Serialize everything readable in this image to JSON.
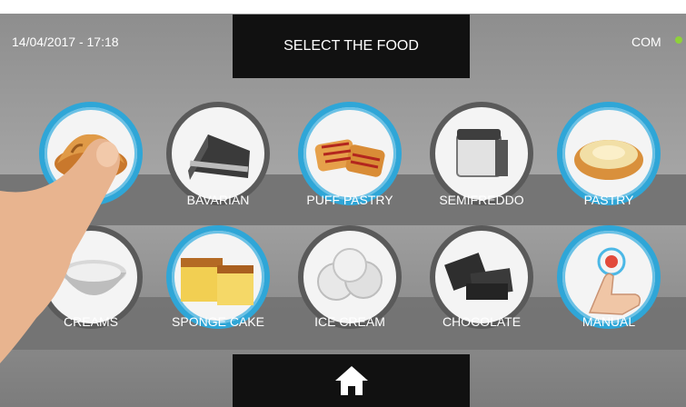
{
  "header": {
    "datetime": "14/04/2017 - 17:18",
    "title": "SELECT THE FOOD",
    "status_label": "COM",
    "status_color": "#8ed13a"
  },
  "foods": [
    {
      "label": "CROISSANTERIE",
      "visible_label": "E",
      "icon": "croissant-icon",
      "active": true
    },
    {
      "label": "BAVARIAN",
      "icon": "cake-slice-icon",
      "active": false
    },
    {
      "label": "PUFF PASTRY",
      "icon": "puff-pastry-icon",
      "active": true
    },
    {
      "label": "SEMIFREDDO",
      "icon": "semifreddo-icon",
      "active": false
    },
    {
      "label": "PASTRY",
      "icon": "tart-icon",
      "active": true
    },
    {
      "label": "CREAMS",
      "icon": "cream-bowl-icon",
      "active": false
    },
    {
      "label": "SPONGE CAKE",
      "icon": "sponge-cake-icon",
      "active": true
    },
    {
      "label": "ICE CREAM",
      "icon": "ice-cream-icon",
      "active": false
    },
    {
      "label": "CHOCOLATE",
      "icon": "chocolate-icon",
      "active": false
    },
    {
      "label": "MANUAL",
      "icon": "touch-hand-icon",
      "active": true
    }
  ],
  "footer": {
    "home_icon": "home-icon"
  },
  "colors": {
    "accent": "#2fa6d7",
    "panel": "#111111",
    "band": "#747474"
  }
}
